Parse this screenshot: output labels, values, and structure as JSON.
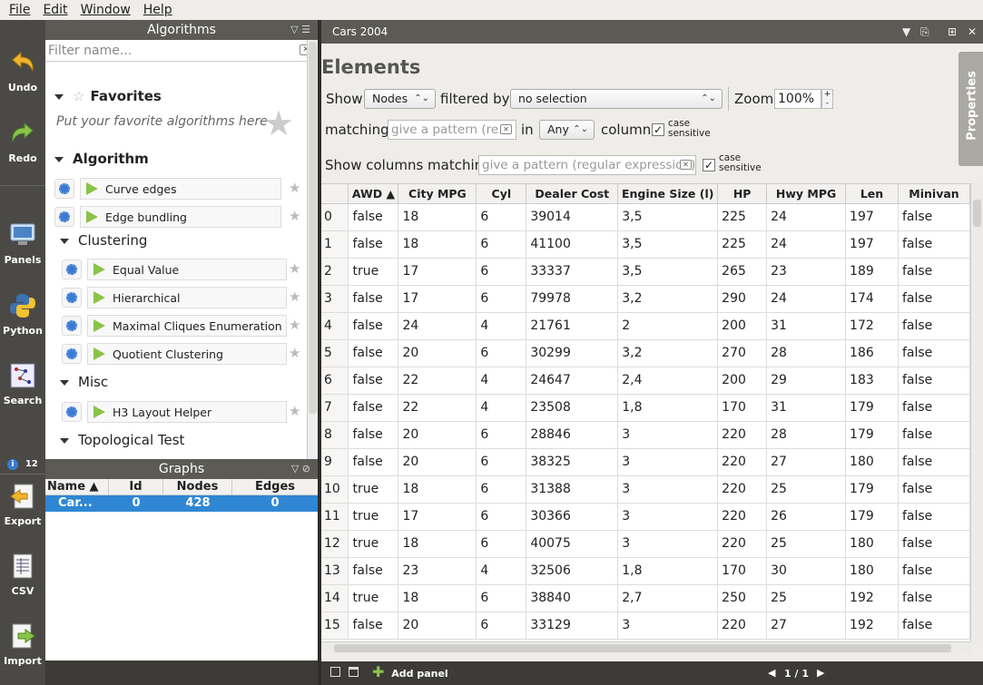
{
  "menu": [
    "File",
    "Edit",
    "Window",
    "Help"
  ],
  "toolbar": [
    {
      "label": "Undo",
      "icon": "undo-icon"
    },
    {
      "label": "Redo",
      "icon": "redo-icon"
    },
    {
      "label": "Panels",
      "icon": "panels-icon"
    },
    {
      "label": "Python",
      "icon": "python-icon"
    },
    {
      "label": "Search",
      "icon": "search-icon"
    },
    {
      "label": "12",
      "icon": "info-icon"
    },
    {
      "label": "Export",
      "icon": "export-icon"
    },
    {
      "label": "CSV",
      "icon": "csv-icon"
    },
    {
      "label": "Import",
      "icon": "import-icon"
    }
  ],
  "algorithms": {
    "title": "Algorithms",
    "filter_placeholder": "Filter name...",
    "favorites": "Favorites",
    "favorites_hint": "Put your favorite algorithms here",
    "algorithm": "Algorithm",
    "items": [
      "Curve edges",
      "Edge bundling"
    ],
    "clustering": "Clustering",
    "clustering_items": [
      "Equal Value",
      "Hierarchical",
      "Maximal Cliques Enumeration",
      "Quotient Clustering"
    ],
    "misc": "Misc",
    "misc_items": [
      "H3 Layout Helper"
    ],
    "topological": "Topological Test"
  },
  "graphs": {
    "title": "Graphs",
    "columns": [
      "Name",
      "Id",
      "Nodes",
      "Edges"
    ],
    "row": [
      "Car...",
      "0",
      "428",
      "0"
    ]
  },
  "panel": {
    "tab_title": "Cars 2004",
    "elements_title": "Elements",
    "show_label": "Show",
    "show_value": "Nodes",
    "filtered_by_label": "filtered by",
    "filtered_by_value": "no selection",
    "zoom_label": "Zoom",
    "zoom_value": "100%",
    "matching_label": "matching",
    "matching_placeholder": "give a pattern (re...",
    "in_label": "in",
    "in_value": "Any",
    "column_label": "column",
    "case_label_1": "case",
    "case_label_2": "sensitive",
    "show_columns_label": "Show columns matching",
    "show_columns_placeholder": "give a pattern (regular expression)",
    "properties_label": "Properties",
    "add_panel_label": "Add panel",
    "page_indicator": "1 / 1"
  },
  "table": {
    "columns": [
      "AWD",
      "City MPG",
      "Cyl",
      "Dealer Cost",
      "Engine Size (l)",
      "HP",
      "Hwy MPG",
      "Len",
      "Minivan"
    ],
    "rows": [
      [
        "0",
        "false",
        "18",
        "6",
        "39014",
        "3,5",
        "225",
        "24",
        "197",
        "false"
      ],
      [
        "1",
        "false",
        "18",
        "6",
        "41100",
        "3,5",
        "225",
        "24",
        "197",
        "false"
      ],
      [
        "2",
        "true",
        "17",
        "6",
        "33337",
        "3,5",
        "265",
        "23",
        "189",
        "false"
      ],
      [
        "3",
        "false",
        "17",
        "6",
        "79978",
        "3,2",
        "290",
        "24",
        "174",
        "false"
      ],
      [
        "4",
        "false",
        "24",
        "4",
        "21761",
        "2",
        "200",
        "31",
        "172",
        "false"
      ],
      [
        "5",
        "false",
        "20",
        "6",
        "30299",
        "3,2",
        "270",
        "28",
        "186",
        "false"
      ],
      [
        "6",
        "false",
        "22",
        "4",
        "24647",
        "2,4",
        "200",
        "29",
        "183",
        "false"
      ],
      [
        "7",
        "false",
        "22",
        "4",
        "23508",
        "1,8",
        "170",
        "31",
        "179",
        "false"
      ],
      [
        "8",
        "false",
        "20",
        "6",
        "28846",
        "3",
        "220",
        "28",
        "179",
        "false"
      ],
      [
        "9",
        "false",
        "20",
        "6",
        "38325",
        "3",
        "220",
        "27",
        "180",
        "false"
      ],
      [
        "10",
        "true",
        "18",
        "6",
        "31388",
        "3",
        "220",
        "25",
        "179",
        "false"
      ],
      [
        "11",
        "true",
        "17",
        "6",
        "30366",
        "3",
        "220",
        "26",
        "179",
        "false"
      ],
      [
        "12",
        "true",
        "18",
        "6",
        "40075",
        "3",
        "220",
        "25",
        "180",
        "false"
      ],
      [
        "13",
        "false",
        "23",
        "4",
        "32506",
        "1,8",
        "170",
        "30",
        "180",
        "false"
      ],
      [
        "14",
        "true",
        "18",
        "6",
        "38840",
        "2,7",
        "250",
        "25",
        "192",
        "false"
      ],
      [
        "15",
        "false",
        "20",
        "6",
        "33129",
        "3",
        "220",
        "27",
        "192",
        "false"
      ]
    ]
  }
}
